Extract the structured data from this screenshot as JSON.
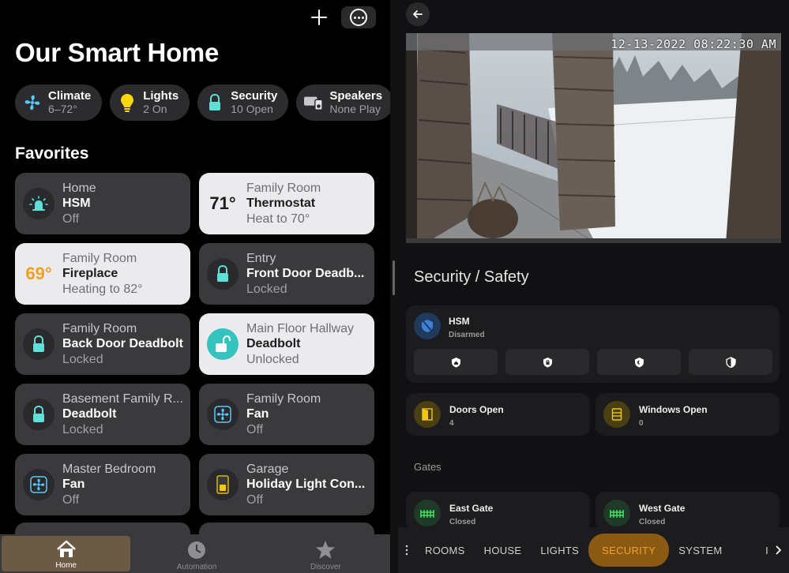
{
  "left": {
    "title": "Our Smart Home",
    "chips": [
      {
        "label": "Climate",
        "sub": "6–72°",
        "icon": "fan-icon"
      },
      {
        "label": "Lights",
        "sub": "2 On",
        "icon": "lightbulb-icon"
      },
      {
        "label": "Security",
        "sub": "10 Open",
        "icon": "lock-icon"
      },
      {
        "label": "Speakers",
        "sub": "None Play",
        "icon": "speaker-icon"
      }
    ],
    "favorites_title": "Favorites",
    "tiles": [
      {
        "room": "Home",
        "name": "HSM",
        "state": "Off",
        "icon": "siren-icon"
      },
      {
        "room": "Family Room",
        "name": "Thermostat",
        "state": "Heat to 70°",
        "temp": "71°"
      },
      {
        "room": "Family Room",
        "name": "Fireplace",
        "state": "Heating to 82°",
        "temp": "69°"
      },
      {
        "room": "Entry",
        "name": "Front Door Deadb...",
        "state": "Locked",
        "icon": "lock-icon"
      },
      {
        "room": "Family Room",
        "name": "Back Door Deadbolt",
        "state": "Locked",
        "icon": "lock-icon"
      },
      {
        "room": "Main Floor Hallway",
        "name": "Deadbolt",
        "state": "Unlocked",
        "icon": "unlocked-icon"
      },
      {
        "room": "Basement Family R...",
        "name": "Deadbolt",
        "state": "Locked",
        "icon": "lock-icon"
      },
      {
        "room": "Family Room",
        "name": "Fan",
        "state": "Off",
        "icon": "fan-icon"
      },
      {
        "room": "Master Bedroom",
        "name": "Fan",
        "state": "Off",
        "icon": "fan-icon"
      },
      {
        "room": "Garage",
        "name": "Holiday Light Con...",
        "state": "Off",
        "icon": "outlet-icon"
      }
    ],
    "tabs": [
      {
        "label": "Home",
        "active": true
      },
      {
        "label": "Automation",
        "active": false
      },
      {
        "label": "Discover",
        "active": false
      }
    ]
  },
  "right": {
    "camera_timestamp": "12-13-2022 08:22:30 AM",
    "section_title": "Security / Safety",
    "hsm": {
      "name": "HSM",
      "state": "Disarmed"
    },
    "doors": {
      "name": "Doors Open",
      "state": "4"
    },
    "windows": {
      "name": "Windows Open",
      "state": "0"
    },
    "gates_label": "Gates",
    "east_gate": {
      "name": "East Gate",
      "state": "Closed"
    },
    "west_gate": {
      "name": "West Gate",
      "state": "Closed"
    },
    "nav": [
      "ROOMS",
      "HOUSE",
      "LIGHTS",
      "SECURITY",
      "SYSTEM"
    ],
    "nav_active": "SECURITY",
    "nav_partial": "I"
  },
  "colors": {
    "accent_teal": "#35c3c0",
    "accent_orange": "#f0a020",
    "nav_active_bg": "#8a5a12",
    "hsm_blue": "#3b82d6"
  }
}
